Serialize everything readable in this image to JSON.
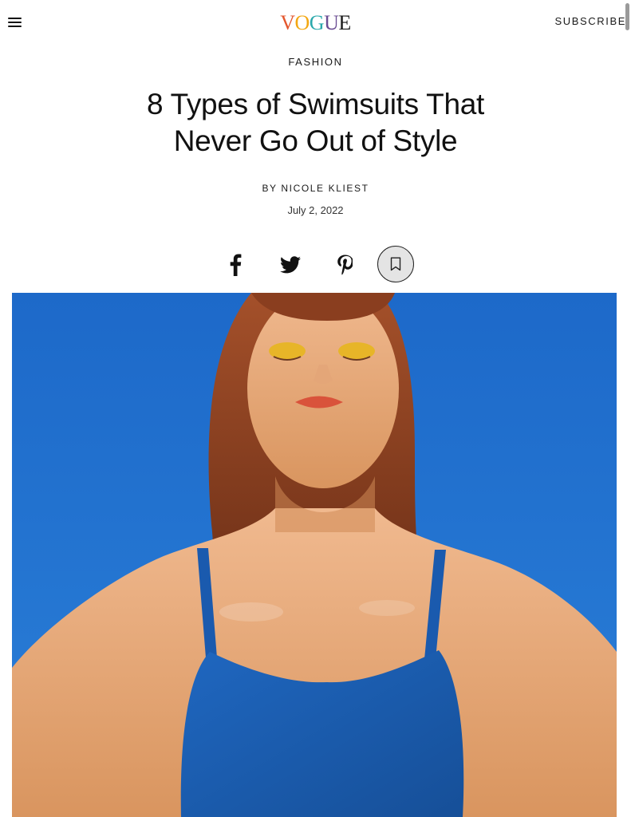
{
  "header": {
    "menu_icon": "hamburger-menu-icon",
    "logo_letters": [
      "V",
      "O",
      "G",
      "U",
      "E"
    ],
    "subscribe_label": "SUBSCRIBE"
  },
  "article": {
    "rubric": "FASHION",
    "headline_line1": "8 Types of Swimsuits That",
    "headline_line2": "Never Go Out of Style",
    "byline": "BY NICOLE KLIEST",
    "date": "July 2, 2022"
  },
  "social": {
    "facebook_icon": "facebook-icon",
    "twitter_icon": "twitter-icon",
    "pinterest_icon": "pinterest-icon",
    "save_icon": "bookmark-icon"
  },
  "colors": {
    "sky_blue": "#1f6fcf",
    "swimsuit_blue": "#1b5fb4",
    "logo_colors": [
      "#e4572e",
      "#f3a712",
      "#29a8ab",
      "#6a4c93",
      "#1a1a1a"
    ]
  }
}
